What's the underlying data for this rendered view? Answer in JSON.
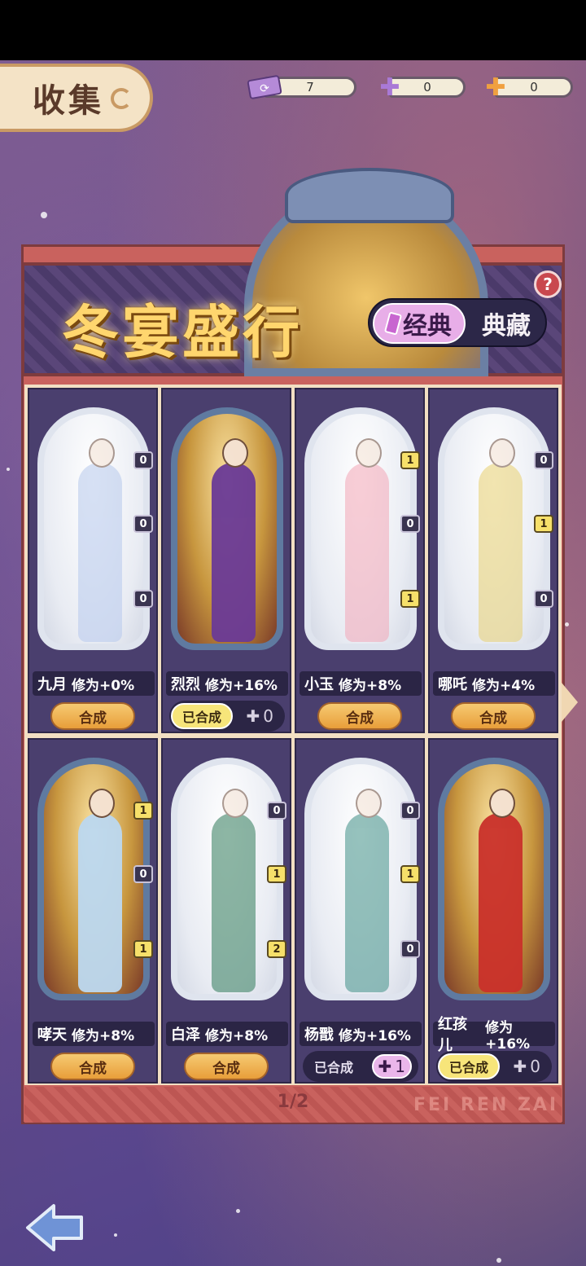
{
  "header": {
    "title": "收集",
    "currencies": [
      {
        "icon": "ticket-icon",
        "value": "7",
        "color": "#b58ad8"
      },
      {
        "icon": "purple-puzzle-icon",
        "value": "0",
        "color": "#a979d6"
      },
      {
        "icon": "orange-puzzle-icon",
        "value": "0",
        "color": "#f0a040"
      }
    ]
  },
  "event": {
    "title": "冬宴盛行",
    "help": "?",
    "modes": {
      "classic": "经典",
      "collection": "典藏",
      "selected": "经典"
    }
  },
  "cards": [
    {
      "name": "九月",
      "stat": "修为+0%",
      "action": "合成",
      "badges": [
        "0",
        "0",
        "0"
      ],
      "badges_on": [
        false,
        false,
        false
      ],
      "ghost": true,
      "figure": "#b7c9ec"
    },
    {
      "name": "烈烈",
      "stat": "修为+16%",
      "merged_label": "已合成",
      "puzzle": "0",
      "ghost": false,
      "figure": "#6a3a96"
    },
    {
      "name": "小玉",
      "stat": "修为+8%",
      "action": "合成",
      "badges": [
        "1",
        "0",
        "1"
      ],
      "badges_on": [
        true,
        false,
        true
      ],
      "ghost": true,
      "figure": "#f3a6b6"
    },
    {
      "name": "哪吒",
      "stat": "修为+4%",
      "action": "合成",
      "badges": [
        "0",
        "1",
        "0"
      ],
      "badges_on": [
        false,
        true,
        false
      ],
      "ghost": true,
      "figure": "#e8d070"
    },
    {
      "name": "哮天",
      "stat": "修为+8%",
      "action": "合成",
      "badges": [
        "1",
        "0",
        "1"
      ],
      "badges_on": [
        true,
        false,
        true
      ],
      "ghost": false,
      "figure": "#bcd8f0"
    },
    {
      "name": "白泽",
      "stat": "修为+8%",
      "action": "合成",
      "badges": [
        "0",
        "1",
        "2"
      ],
      "badges_on": [
        false,
        true,
        true
      ],
      "ghost": true,
      "figure": "#2f7a5a"
    },
    {
      "name": "杨戬",
      "stat": "修为+16%",
      "merged_label": "已合成",
      "puzzle": "1",
      "ghost": true,
      "figure": "#3f8f86",
      "badges": [
        "0",
        "1",
        "0"
      ],
      "badges_on": [
        false,
        true,
        false
      ]
    },
    {
      "name": "红孩儿",
      "stat": "修为+16%",
      "merged_label": "已合成",
      "puzzle": "0",
      "ghost": false,
      "figure": "#c9302a"
    }
  ],
  "pagination": {
    "page": "1/2"
  },
  "watermark": "FEI REN ZAI",
  "nav": {
    "back_icon": "back-arrow-icon",
    "next_icon": "next-arrow-icon"
  }
}
